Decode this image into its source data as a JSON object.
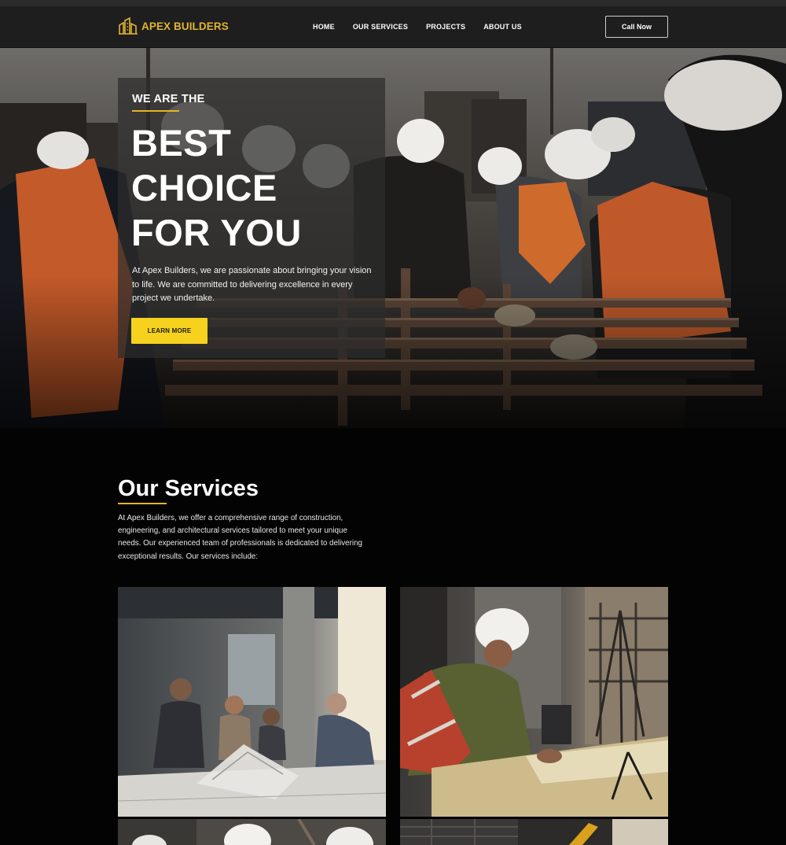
{
  "brand": {
    "name": "APEX BUILDERS",
    "accent": "#e0b531",
    "button_yellow": "#f6d21e"
  },
  "nav": {
    "items": [
      "HOME",
      "OUR SERVICES",
      "PROJECTS",
      "ABOUT US"
    ],
    "cta": "Call Now"
  },
  "hero": {
    "kicker": "WE ARE THE",
    "headline": [
      "BEST",
      "CHOICE",
      "FOR YOU"
    ],
    "text": "At Apex Builders, we are passionate about bringing your vision to life. We are committed to delivering excellence in every project we undertake.",
    "button": "LEARN MORE",
    "image": "construction-workers-photo"
  },
  "services": {
    "title": "Our Services",
    "description": "At Apex Builders, we offer a comprehensive range of construction, engineering, and architectural services tailored to meet your unique needs. Our experienced team of professionals is dedicated to delivering exceptional results. Our services include:",
    "cards": [
      {
        "image": "architects-reviewing-model-photo"
      },
      {
        "image": "engineer-measuring-photo"
      },
      {
        "image": "workers-hardhats-photo"
      },
      {
        "image": "excavator-site-photo"
      }
    ]
  }
}
